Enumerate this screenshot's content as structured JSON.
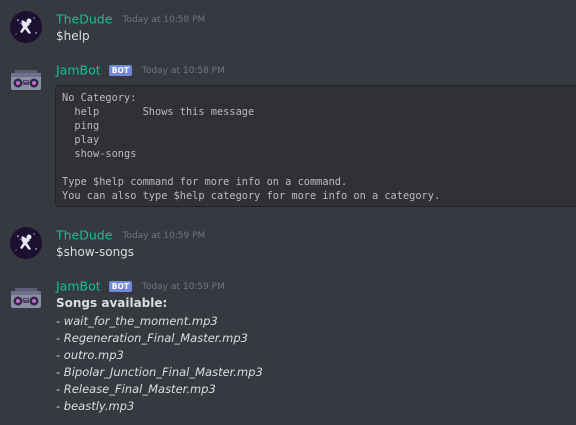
{
  "messages": [
    {
      "author": "TheDude",
      "timestamp": "Today at 10:58 PM",
      "text": "$help"
    },
    {
      "author": "JamBot",
      "bot_tag": "BOT",
      "timestamp": "Today at 10:58 PM",
      "code_lines": [
        "No Category:",
        "  help       Shows this message",
        "  ping",
        "  play",
        "  show-songs",
        "",
        "Type $help command for more info on a command.",
        "You can also type $help category for more info on a category."
      ]
    },
    {
      "author": "TheDude",
      "timestamp": "Today at 10:59 PM",
      "text": "$show-songs"
    },
    {
      "author": "JamBot",
      "bot_tag": "BOT",
      "timestamp": "Today at 10:59 PM",
      "songs_title": "Songs available:",
      "songs": [
        "- wait_for_the_moment.mp3",
        "- Regeneration_Final_Master.mp3",
        "- outro.mp3",
        "- Bipolar_Junction_Final_Master.mp3",
        "- Release_Final_Master.mp3",
        "- beastly.mp3"
      ]
    }
  ],
  "colors": {
    "background": "#36393f",
    "username": "#1abc9c",
    "bot_tag": "#7289da",
    "timestamp": "#72767d",
    "text": "#dcddde",
    "code_background": "#2f3136"
  },
  "icons": {
    "user_avatar": "astronaut-avatar-icon",
    "bot_avatar": "boombox-avatar-icon"
  }
}
